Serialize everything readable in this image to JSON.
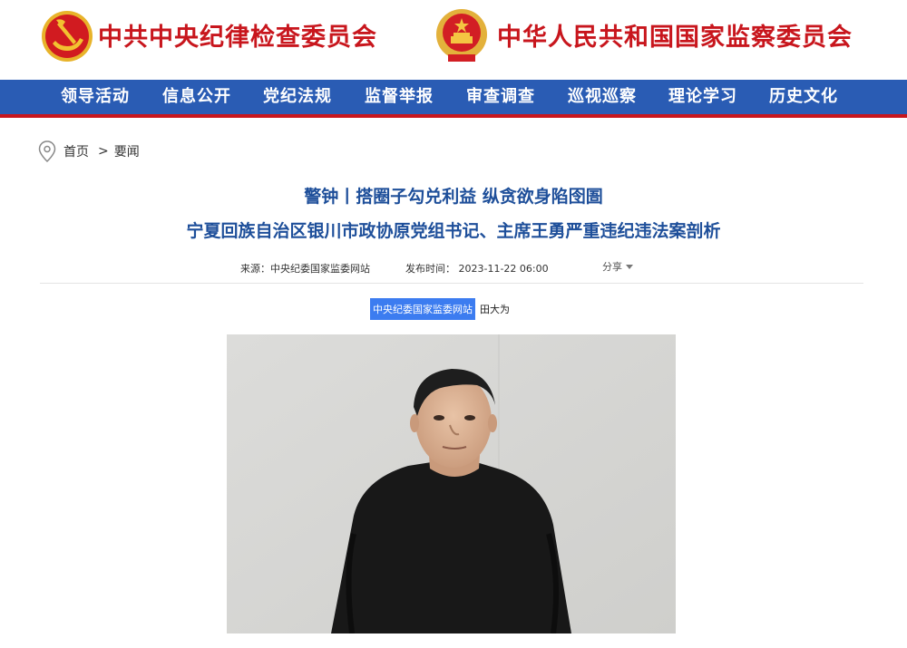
{
  "header": {
    "org1_name": "中共中央纪律检查委员会",
    "org2_name": "中华人民共和国国家监察委员会",
    "org1_emblem_icon": "party-emblem-icon",
    "org2_emblem_icon": "national-emblem-icon"
  },
  "nav": {
    "items": [
      "领导活动",
      "信息公开",
      "党纪法规",
      "监督举报",
      "审查调查",
      "巡视巡察",
      "理论学习",
      "历史文化"
    ]
  },
  "breadcrumb": {
    "home": "首页",
    "separator": ">",
    "current": "要闻"
  },
  "article": {
    "title_line1": "警钟丨搭圈子勾兑利益 纵贪欲身陷囹圄",
    "title_line2": "宁夏回族自治区银川市政协原党组书记、主席王勇严重违纪违法案剖析",
    "source": "来源：中央纪委国家监委网站",
    "publish_time": "发布时间： 2023-11-22 06:00",
    "share_label": "分享",
    "byline_source": "中央纪委国家监委网站",
    "byline_author": "田大为"
  },
  "colors": {
    "brand_red": "#c8161d",
    "nav_blue": "#2a5cb4",
    "title_blue": "#1e4f9a",
    "highlight_blue": "#3c7cf0"
  }
}
